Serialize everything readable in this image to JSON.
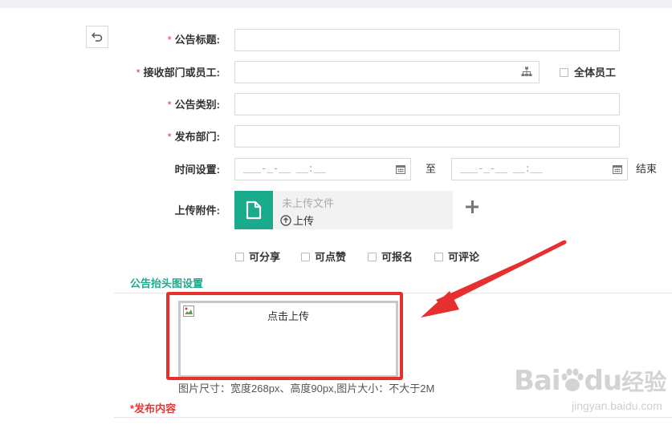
{
  "form": {
    "title_label": "公告标题:",
    "receiver_label": "接收部门或员工:",
    "all_staff_label": "全体员工",
    "category_label": "公告类别:",
    "publish_dept_label": "发布部门:",
    "time_label": "时间设置:",
    "time_start_placeholder": "___-_-__ __:__",
    "time_to": "至",
    "time_end_placeholder": "___-_-__ __:__",
    "time_end_label": "结束",
    "attach_label": "上传附件:",
    "attach_status": "未上传文件",
    "attach_upload": "上传",
    "options": [
      "可分享",
      "可点赞",
      "可报名",
      "可评论"
    ],
    "required_mark": "*"
  },
  "header_image": {
    "section_title": "公告抬头图设置",
    "upload_text": "点击上传",
    "hint": "图片尺寸：宽度268px、高度90px,图片大小：不大于2M"
  },
  "content": {
    "section_title": "发布内容"
  },
  "watermark": {
    "brand": "Bai",
    "brand2": "du",
    "cn": "经验",
    "url": "jingyan.baidu.com"
  },
  "colors": {
    "accent": "#1aaa8c",
    "required": "#e53935",
    "highlight": "#e5302f"
  },
  "icons": [
    "undo-icon",
    "org-tree-icon",
    "calendar-icon",
    "file-icon",
    "upload-icon",
    "plus-icon",
    "broken-image-icon"
  ]
}
